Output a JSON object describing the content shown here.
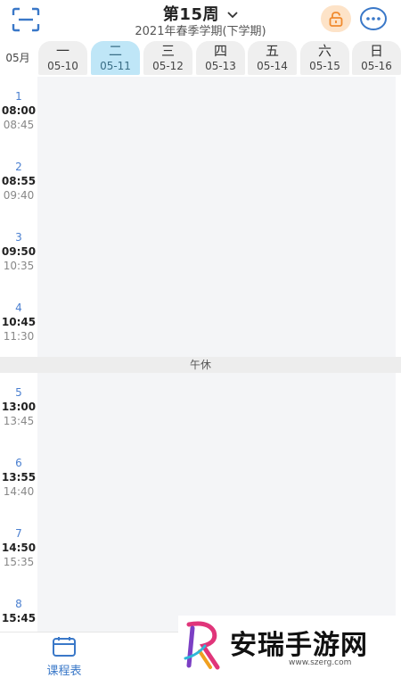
{
  "header": {
    "week_title": "第15周",
    "semester": "2021年春季学期(下学期)"
  },
  "days": {
    "month": "05月",
    "items": [
      {
        "weekday": "一",
        "date": "05-10",
        "active": false
      },
      {
        "weekday": "二",
        "date": "05-11",
        "active": true
      },
      {
        "weekday": "三",
        "date": "05-12",
        "active": false
      },
      {
        "weekday": "四",
        "date": "05-13",
        "active": false
      },
      {
        "weekday": "五",
        "date": "05-14",
        "active": false
      },
      {
        "weekday": "六",
        "date": "05-15",
        "active": false
      },
      {
        "weekday": "日",
        "date": "05-16",
        "active": false
      }
    ]
  },
  "periods": [
    {
      "num": "1",
      "start": "08:00",
      "end": "08:45"
    },
    {
      "num": "2",
      "start": "08:55",
      "end": "09:40"
    },
    {
      "num": "3",
      "start": "09:50",
      "end": "10:35"
    },
    {
      "num": "4",
      "start": "10:45",
      "end": "11:30"
    },
    {
      "num": "5",
      "start": "13:00",
      "end": "13:45"
    },
    {
      "num": "6",
      "start": "13:55",
      "end": "14:40"
    },
    {
      "num": "7",
      "start": "14:50",
      "end": "15:35"
    },
    {
      "num": "8",
      "start": "15:45",
      "end": ""
    }
  ],
  "lunch_label": "午休",
  "bottom_tab": {
    "label": "课程表"
  },
  "watermark": {
    "text": "安瑞手游网",
    "url": "www.szerg.com"
  },
  "colors": {
    "accent": "#3a78c8",
    "active_day": "#bfe6f7",
    "lock_bg": "#fde3c8"
  }
}
